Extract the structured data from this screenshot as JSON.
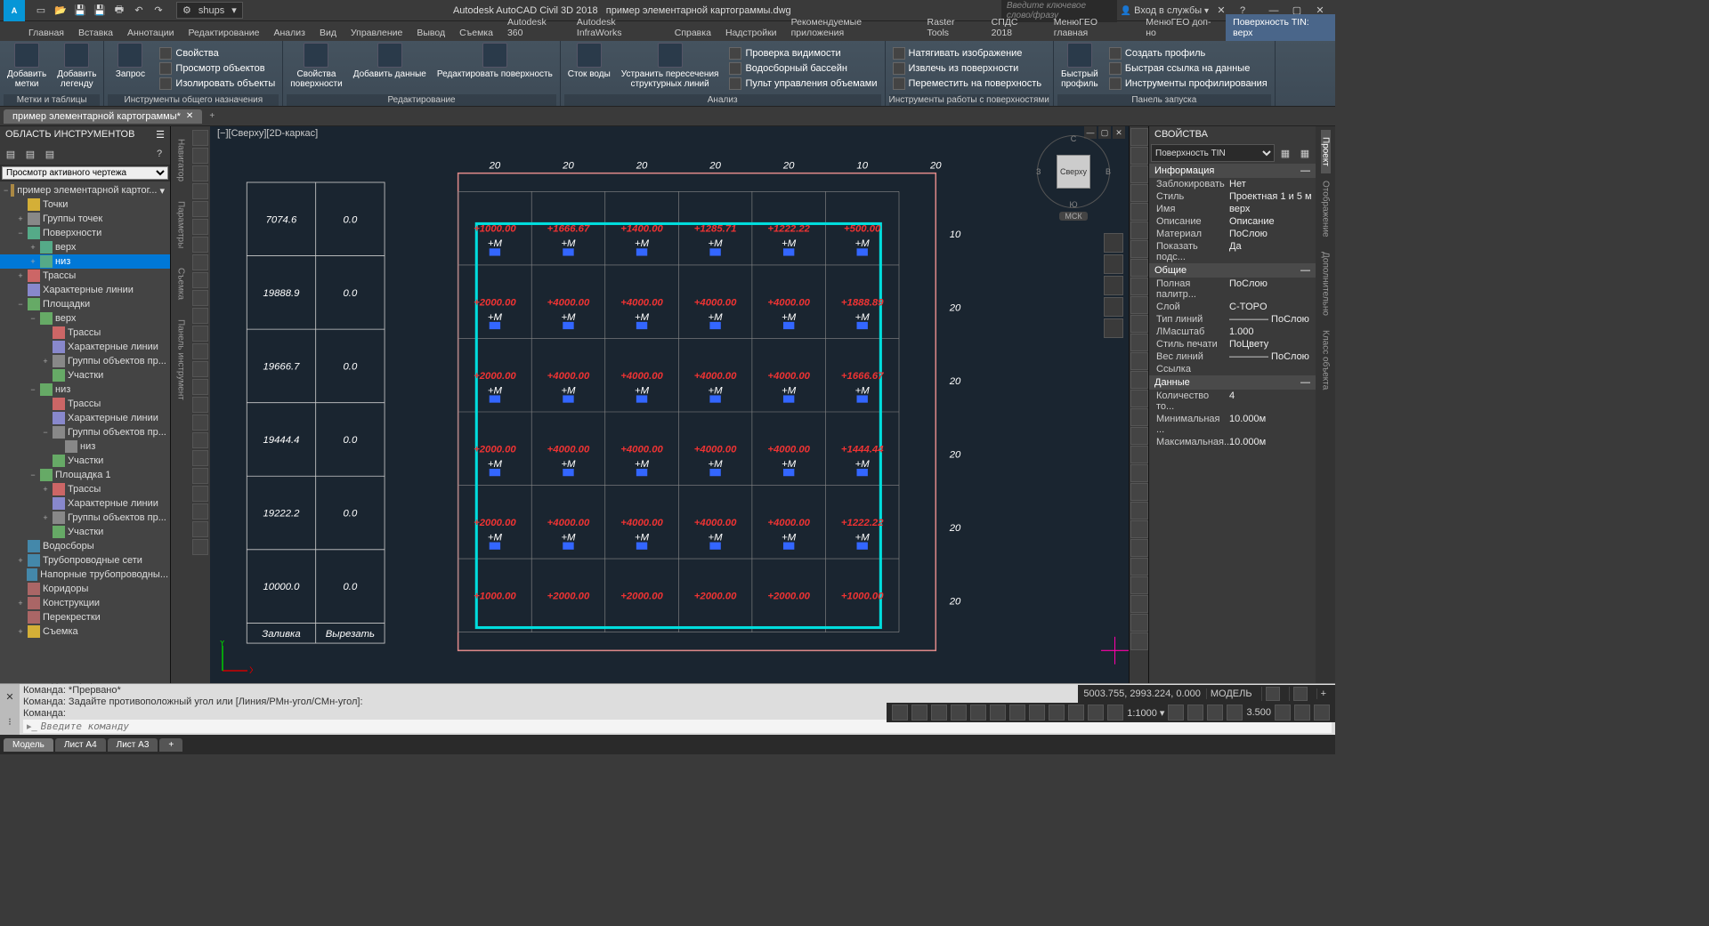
{
  "title_bar": {
    "app": "Autodesk AutoCAD Civil 3D 2018",
    "file": "пример элементарной картограммы.dwg",
    "workspace": "shups",
    "keyword_placeholder": "Введите ключевое слово/фразу",
    "signin": "Вход в службы"
  },
  "ribbon_tabs": [
    "Главная",
    "Вставка",
    "Аннотации",
    "Редактирование",
    "Анализ",
    "Вид",
    "Управление",
    "Вывод",
    "Съемка",
    "Autodesk 360",
    "Autodesk InfraWorks",
    "Справка",
    "Надстройки",
    "Рекомендуемые приложения",
    "Raster Tools",
    "СПДС 2018",
    "МенюГЕО главная",
    "МенюГЕО доп-но",
    "Поверхность TIN: верх"
  ],
  "ribbon_active": 18,
  "ribbon_panels": {
    "p1": {
      "title": "Метки и таблицы",
      "big": [
        {
          "lbl": "Добавить\nметки"
        },
        {
          "lbl": "Добавить\nлегенду"
        }
      ]
    },
    "p2": {
      "title": "Инструменты общего назначения",
      "big": [
        {
          "lbl": "Запрос"
        }
      ],
      "small": [
        "Свойства",
        "Просмотр объектов",
        "Изолировать объекты"
      ]
    },
    "p3": {
      "title": "Редактирование",
      "big": [
        {
          "lbl": "Свойства\nповерхности"
        },
        {
          "lbl": "Добавить данные"
        },
        {
          "lbl": "Редактировать поверхность"
        }
      ]
    },
    "p4": {
      "title": "Анализ",
      "big": [
        {
          "lbl": "Сток воды"
        },
        {
          "lbl": "Устранить пересечения\nструктурных линий"
        }
      ],
      "small": [
        "Проверка видимости",
        "Водосборный бассейн",
        "Пульт управления объемами"
      ]
    },
    "p5": {
      "title": "Инструменты работы с поверхностями",
      "small": [
        "Натягивать изображение",
        "Извлечь из поверхности",
        "Переместить на поверхность"
      ]
    },
    "p6": {
      "title": "Панель запуска",
      "big": [
        {
          "lbl": "Быстрый\nпрофиль"
        }
      ],
      "small": [
        "Создать профиль",
        "Быстрая ссылка на данные",
        "Инструменты профилирования"
      ]
    }
  },
  "file_tab": {
    "name": "пример элементарной картограммы*"
  },
  "toolspace": {
    "title": "ОБЛАСТЬ ИНСТРУМЕНТОВ",
    "search": "Просмотр активного чертежа",
    "tree": [
      {
        "d": 0,
        "e": "−",
        "ic": "ic-site",
        "t": "пример элементарной картог...",
        "ex": "▾"
      },
      {
        "d": 1,
        "e": "",
        "ic": "ic-pt",
        "t": "Точки"
      },
      {
        "d": 1,
        "e": "+",
        "ic": "ic-grp",
        "t": "Группы точек"
      },
      {
        "d": 1,
        "e": "−",
        "ic": "ic-surf",
        "t": "Поверхности"
      },
      {
        "d": 2,
        "e": "+",
        "ic": "ic-surf",
        "t": "верх"
      },
      {
        "d": 2,
        "e": "+",
        "ic": "ic-surf",
        "t": "низ",
        "sel": true
      },
      {
        "d": 1,
        "e": "+",
        "ic": "ic-aln",
        "t": "Трассы"
      },
      {
        "d": 1,
        "e": "",
        "ic": "ic-line",
        "t": "Характерные линии"
      },
      {
        "d": 1,
        "e": "−",
        "ic": "ic-parc",
        "t": "Площадки"
      },
      {
        "d": 2,
        "e": "−",
        "ic": "ic-parc",
        "t": "верх"
      },
      {
        "d": 3,
        "e": "",
        "ic": "ic-aln",
        "t": "Трассы"
      },
      {
        "d": 3,
        "e": "",
        "ic": "ic-line",
        "t": "Характерные линии"
      },
      {
        "d": 3,
        "e": "+",
        "ic": "ic-grp",
        "t": "Группы объектов пр..."
      },
      {
        "d": 3,
        "e": "",
        "ic": "ic-parc",
        "t": "Участки"
      },
      {
        "d": 2,
        "e": "−",
        "ic": "ic-parc",
        "t": "низ"
      },
      {
        "d": 3,
        "e": "",
        "ic": "ic-aln",
        "t": "Трассы"
      },
      {
        "d": 3,
        "e": "",
        "ic": "ic-line",
        "t": "Характерные линии"
      },
      {
        "d": 3,
        "e": "−",
        "ic": "ic-grp",
        "t": "Группы объектов пр..."
      },
      {
        "d": 4,
        "e": "",
        "ic": "ic-grp",
        "t": "низ"
      },
      {
        "d": 3,
        "e": "",
        "ic": "ic-parc",
        "t": "Участки"
      },
      {
        "d": 2,
        "e": "−",
        "ic": "ic-parc",
        "t": "Площадка 1"
      },
      {
        "d": 3,
        "e": "+",
        "ic": "ic-aln",
        "t": "Трассы"
      },
      {
        "d": 3,
        "e": "",
        "ic": "ic-line",
        "t": "Характерные линии"
      },
      {
        "d": 3,
        "e": "+",
        "ic": "ic-grp",
        "t": "Группы объектов пр..."
      },
      {
        "d": 3,
        "e": "",
        "ic": "ic-parc",
        "t": "Участки"
      },
      {
        "d": 1,
        "e": "",
        "ic": "ic-net",
        "t": "Водосборы"
      },
      {
        "d": 1,
        "e": "+",
        "ic": "ic-net",
        "t": "Трубопроводные сети"
      },
      {
        "d": 1,
        "e": "",
        "ic": "ic-net",
        "t": "Напорные трубопроводны..."
      },
      {
        "d": 1,
        "e": "",
        "ic": "ic-crd",
        "t": "Коридоры"
      },
      {
        "d": 1,
        "e": "+",
        "ic": "ic-crd",
        "t": "Конструкции"
      },
      {
        "d": 1,
        "e": "",
        "ic": "ic-crd",
        "t": "Перекрестки"
      },
      {
        "d": 1,
        "e": "+",
        "ic": "ic-pt",
        "t": "Съемка"
      }
    ]
  },
  "vrail_left": [
    "Навигатор",
    "Параметры",
    "Съемка",
    "Панель инструмент"
  ],
  "viewport": {
    "label": "[−][Сверху][2D-каркас]"
  },
  "viewcube": {
    "n": "С",
    "s": "Ю",
    "e": "В",
    "w": "З",
    "face": "Сверху",
    "msk": "МСК"
  },
  "props": {
    "title": "СВОЙСТВА",
    "type": "Поверхность TIN",
    "sections": [
      {
        "h": "Информация",
        "rows": [
          {
            "k": "Заблокировать",
            "v": "Нет"
          },
          {
            "k": "Стиль",
            "v": "Проектная 1 и 5 м"
          },
          {
            "k": "Имя",
            "v": "верх"
          },
          {
            "k": "Описание",
            "v": "Описание"
          },
          {
            "k": "Материал",
            "v": "ПоСлою"
          },
          {
            "k": "Показать подс...",
            "v": "Да"
          }
        ]
      },
      {
        "h": "Общие",
        "rows": [
          {
            "k": "Полная палитр...",
            "v": "ПоСлою"
          },
          {
            "k": "Слой",
            "v": "C-TOPO"
          },
          {
            "k": "Тип линий",
            "v": "———— ПоСлою"
          },
          {
            "k": "ЛМасштаб",
            "v": "1.000"
          },
          {
            "k": "Стиль печати",
            "v": "ПоЦвету"
          },
          {
            "k": "Вес линий",
            "v": "———— ПоСлою"
          },
          {
            "k": "Ссылка",
            "v": ""
          }
        ]
      },
      {
        "h": "Данные",
        "rows": [
          {
            "k": "Количество то...",
            "v": "4"
          },
          {
            "k": "Минимальная ...",
            "v": "10.000м"
          },
          {
            "k": "Максимальная...",
            "v": "10.000м"
          }
        ]
      }
    ],
    "side": [
      "Проект",
      "Отображение",
      "Дополнительно",
      "Класс объекта"
    ]
  },
  "cmd": {
    "lines": [
      "Команда: *Прервано*",
      "Команда: *Прервано*",
      "Команда: Задайте противоположный угол или [Линия/РМн-угол/СМн-угол]:",
      "Команда:"
    ],
    "placeholder": "Введите команду"
  },
  "bottom_tabs": [
    "Модель",
    "Лист А4",
    "Лист А3"
  ],
  "status": {
    "coords": "5003.755, 2993.224, 0.000",
    "space": "МОДЕЛЬ",
    "scale": "1:1000",
    "val": "3.500"
  },
  "chart_data": {
    "type": "table",
    "figure": "Cartogram grid with left summary table",
    "grid": {
      "top_dims": [
        "20",
        "20",
        "20",
        "20",
        "20",
        "10",
        "20"
      ],
      "right_dims": [
        "10",
        "20",
        "20",
        "20",
        "20",
        "20"
      ],
      "cells": [
        {
          "row": 0,
          "vals": [
            "+1000.00",
            "+1666.67",
            "+1400.00",
            "+1285.71",
            "+1222.22",
            "+500.00"
          ]
        },
        {
          "row": 1,
          "vals": [
            "+2000.00",
            "+4000.00",
            "+4000.00",
            "+4000.00",
            "+4000.00",
            "+1888.89"
          ]
        },
        {
          "row": 2,
          "vals": [
            "+2000.00",
            "+4000.00",
            "+4000.00",
            "+4000.00",
            "+4000.00",
            "+1666.67"
          ]
        },
        {
          "row": 3,
          "vals": [
            "+2000.00",
            "+4000.00",
            "+4000.00",
            "+4000.00",
            "+4000.00",
            "+1444.44"
          ]
        },
        {
          "row": 4,
          "vals": [
            "+2000.00",
            "+4000.00",
            "+4000.00",
            "+4000.00",
            "+4000.00",
            "+1222.22"
          ]
        },
        {
          "row": 5,
          "vals": [
            "+1000.00",
            "+2000.00",
            "+2000.00",
            "+2000.00",
            "+2000.00",
            "+1000.00"
          ]
        }
      ]
    },
    "summary_table": {
      "rows": [
        [
          "7074.6",
          "0.0"
        ],
        [
          "19888.9",
          "0.0"
        ],
        [
          "19666.7",
          "0.0"
        ],
        [
          "19444.4",
          "0.0"
        ],
        [
          "19222.2",
          "0.0"
        ],
        [
          "10000.0",
          "0.0"
        ]
      ],
      "footer": [
        "Заливка",
        "Вырезать"
      ]
    }
  }
}
